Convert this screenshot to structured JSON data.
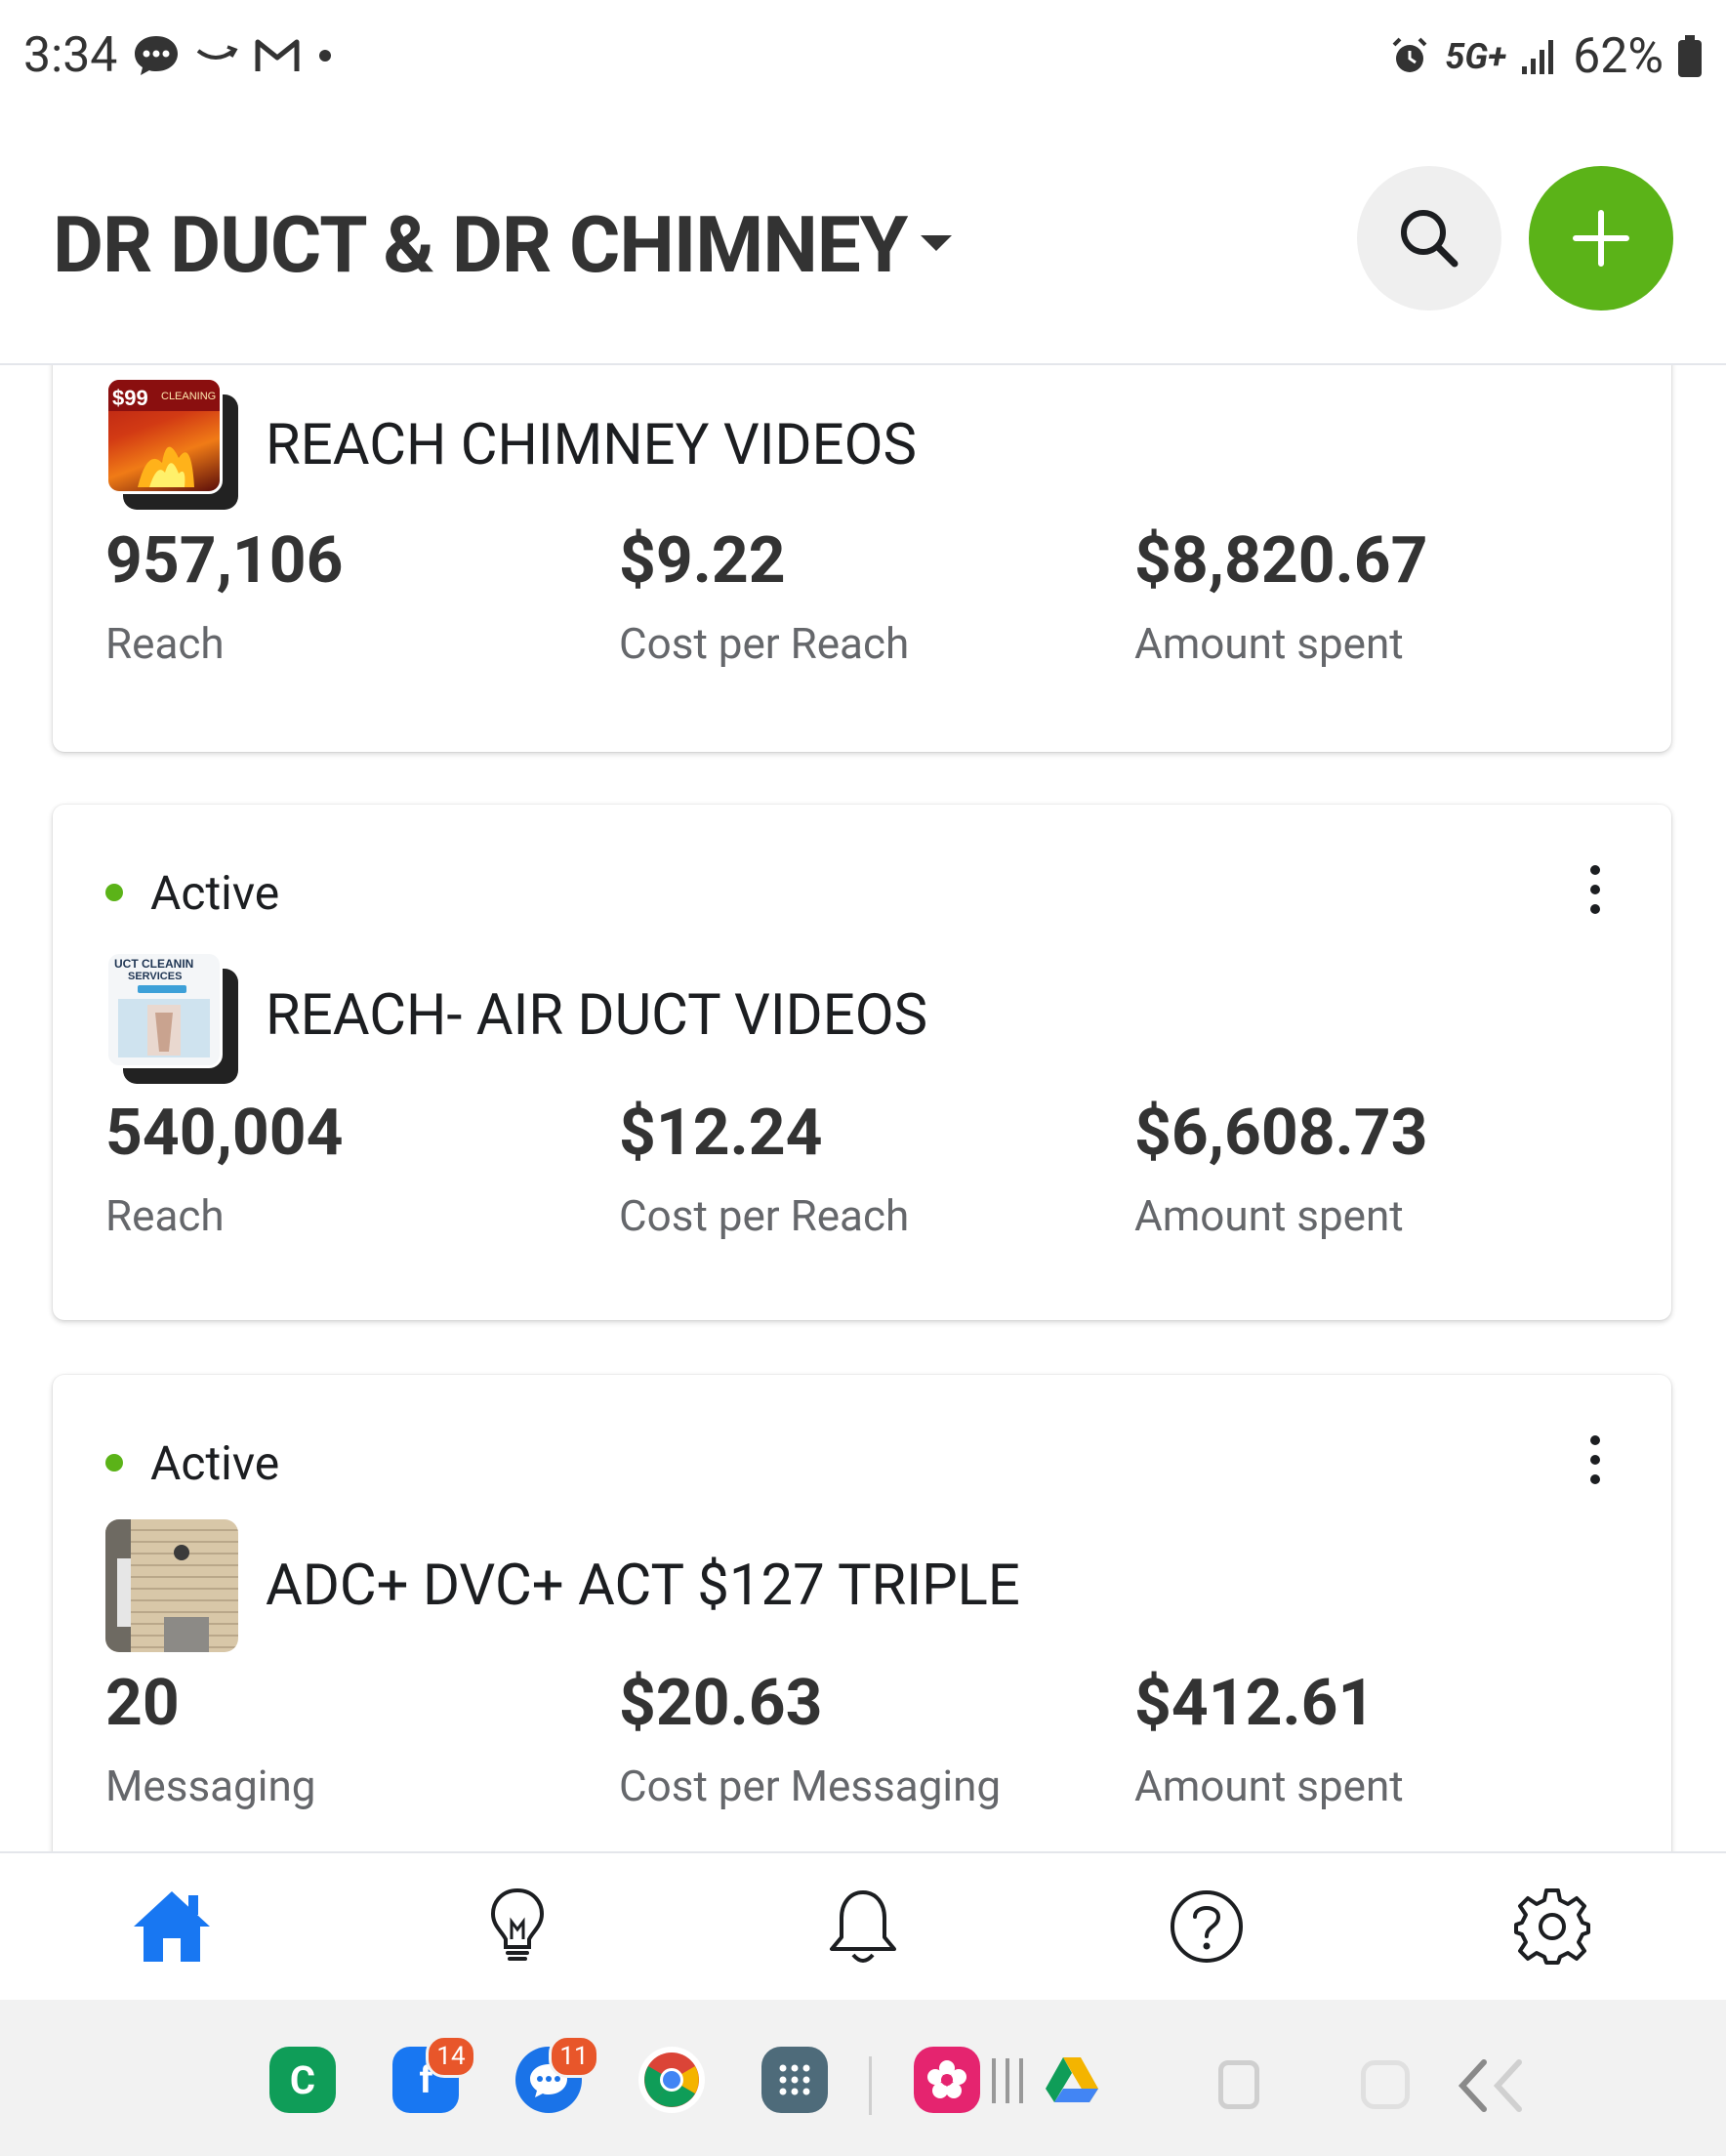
{
  "status_bar": {
    "time": "3:34",
    "network": "5G+",
    "battery": "62%"
  },
  "header": {
    "account_name": "DR DUCT & DR CHIMNEY",
    "accent_color": "#5bb318"
  },
  "campaigns": [
    {
      "status": "",
      "name": "REACH CHIMNEY VIDEOS",
      "thumbnail": "fireplace-ad",
      "metrics": [
        {
          "value": "957,106",
          "label": "Reach"
        },
        {
          "value": "$9.22",
          "label": "Cost per Reach"
        },
        {
          "value": "$8,820.67",
          "label": "Amount spent"
        }
      ]
    },
    {
      "status": "Active",
      "name": "REACH- AIR DUCT VIDEOS",
      "thumbnail": "duct-cleaning-ad",
      "metrics": [
        {
          "value": "540,004",
          "label": "Reach"
        },
        {
          "value": "$12.24",
          "label": "Cost per Reach"
        },
        {
          "value": "$6,608.73",
          "label": "Amount spent"
        }
      ]
    },
    {
      "status": "Active",
      "name": "ADC+ DVC+ ACT $127 TRIPLE",
      "thumbnail": "house-siding-vent",
      "metrics": [
        {
          "value": "20",
          "label": "Messaging"
        },
        {
          "value": "$20.63",
          "label": "Cost per Messaging"
        },
        {
          "value": "$412.61",
          "label": "Amount spent"
        }
      ]
    }
  ],
  "bottom_nav": [
    "home-icon",
    "lightbulb-icon",
    "bell-icon",
    "help-icon",
    "gear-icon"
  ],
  "system_nav": {
    "facebook_badge": "14",
    "messages_badge": "11"
  }
}
